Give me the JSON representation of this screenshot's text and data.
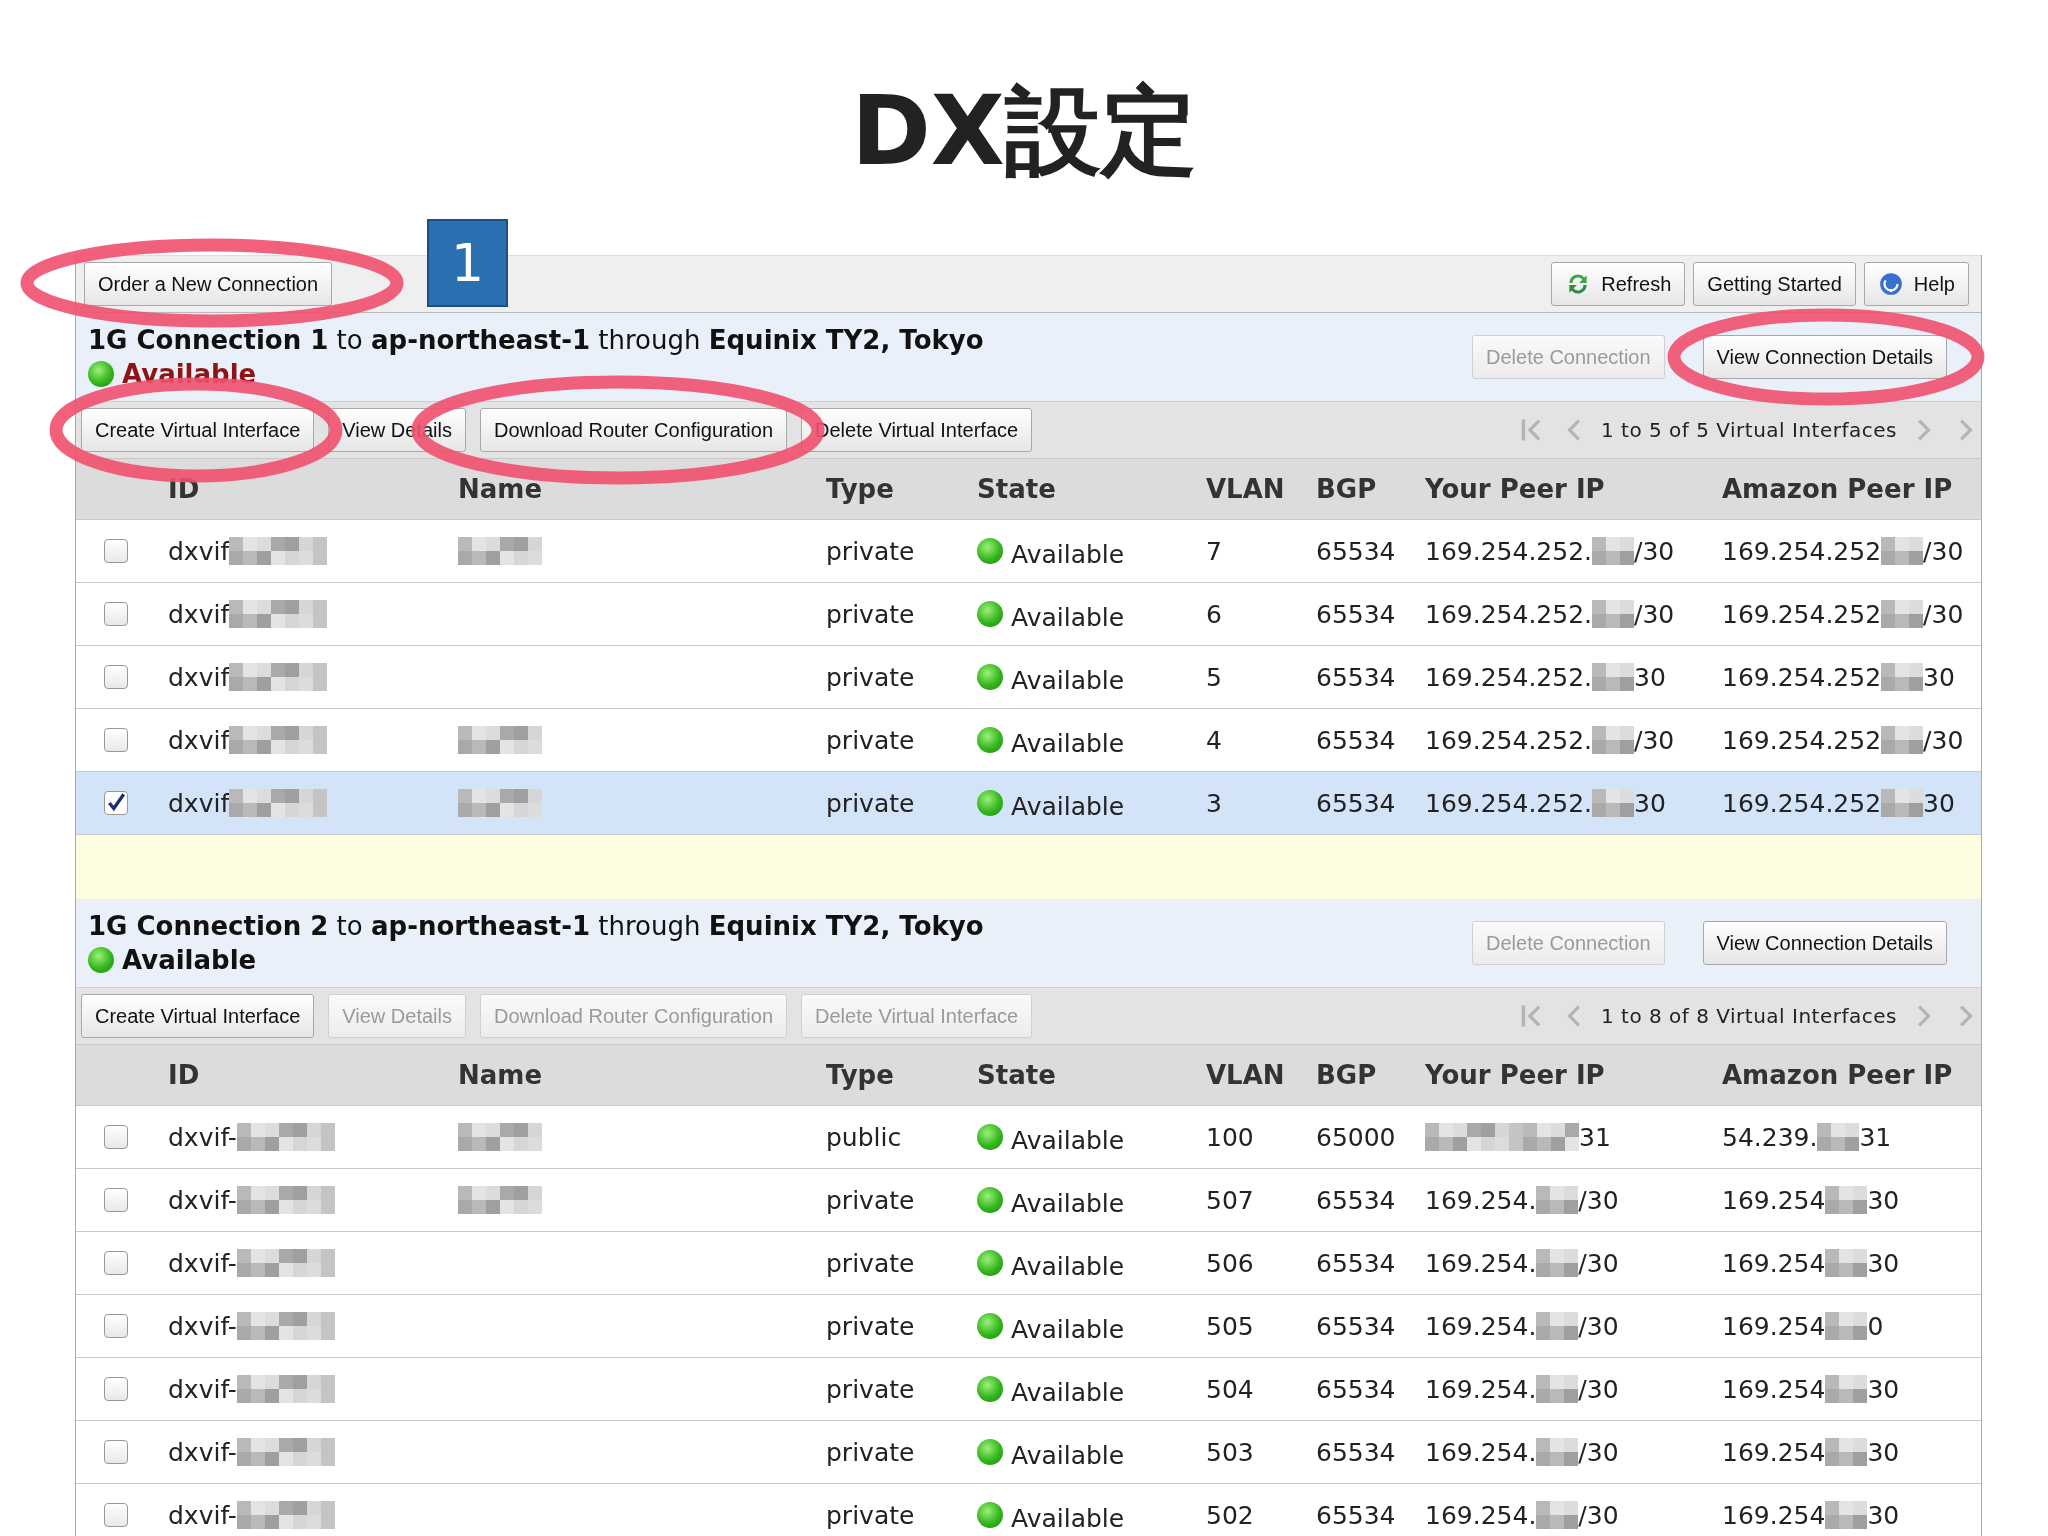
{
  "slide_title": "DX設定",
  "step_badge": "1",
  "toolbar": {
    "left_buttons": [
      {
        "label": "Order a New Connection"
      }
    ],
    "right_buttons": [
      {
        "label": "Refresh"
      },
      {
        "label": "Getting Started"
      },
      {
        "label": "Help"
      }
    ]
  },
  "connections": [
    {
      "title": "**1G Connection 1** to **ap-northeast-1** through **Equinix TY2, Tokyo**",
      "status": "Available",
      "selected": true,
      "actions": [
        {
          "label": "Delete Connection",
          "disabled": true
        },
        {
          "label": "View Connection Details",
          "disabled": false
        }
      ],
      "vi_buttons": [
        {
          "label": "Create Virtual Interface",
          "disabled": false
        },
        {
          "label": "View Details",
          "disabled": false
        },
        {
          "label": "Download Router Configuration",
          "disabled": false
        },
        {
          "label": "Delete Virtual Interface",
          "disabled": false
        }
      ],
      "pager": "1 to 5 of 5 Virtual Interfaces",
      "columns": [
        "ID",
        "Name",
        "Type",
        "State",
        "VLAN",
        "BGP",
        "Your Peer IP",
        "Amazon Peer IP"
      ],
      "rows": [
        {
          "checked": false,
          "selected": false,
          "id": "dxvif",
          "name_redacted": true,
          "type": "private",
          "state": "Available",
          "vlan": "7",
          "bgp": "65534",
          "your_peer_ip": {
            "prefix": "169.254.252.",
            "suffix": "/30"
          },
          "amazon_peer_ip": {
            "prefix": "169.254.252",
            "suffix": "/30"
          }
        },
        {
          "checked": false,
          "selected": false,
          "id": "dxvif",
          "name_redacted": false,
          "type": "private",
          "state": "Available",
          "vlan": "6",
          "bgp": "65534",
          "your_peer_ip": {
            "prefix": "169.254.252.",
            "suffix": "/30"
          },
          "amazon_peer_ip": {
            "prefix": "169.254.252",
            "suffix": "/30"
          }
        },
        {
          "checked": false,
          "selected": false,
          "id": "dxvif",
          "name_redacted": false,
          "type": "private",
          "state": "Available",
          "vlan": "5",
          "bgp": "65534",
          "your_peer_ip": {
            "prefix": "169.254.252.",
            "suffix": "30"
          },
          "amazon_peer_ip": {
            "prefix": "169.254.252",
            "suffix": "30"
          }
        },
        {
          "checked": false,
          "selected": false,
          "id": "dxvif",
          "name_redacted": true,
          "type": "private",
          "state": "Available",
          "vlan": "4",
          "bgp": "65534",
          "your_peer_ip": {
            "prefix": "169.254.252.",
            "suffix": "/30"
          },
          "amazon_peer_ip": {
            "prefix": "169.254.252",
            "suffix": "/30"
          }
        },
        {
          "checked": true,
          "selected": true,
          "id": "dxvif",
          "name_redacted": true,
          "type": "private",
          "state": "Available",
          "vlan": "3",
          "bgp": "65534",
          "your_peer_ip": {
            "prefix": "169.254.252.",
            "suffix": "30"
          },
          "amazon_peer_ip": {
            "prefix": "169.254.252",
            "suffix": "30"
          }
        }
      ]
    },
    {
      "title": "**1G Connection 2** to **ap-northeast-1** through **Equinix TY2, Tokyo**",
      "status": "Available",
      "selected": false,
      "actions": [
        {
          "label": "Delete Connection",
          "disabled": true
        },
        {
          "label": "View Connection Details",
          "disabled": false
        }
      ],
      "vi_buttons": [
        {
          "label": "Create Virtual Interface",
          "disabled": false
        },
        {
          "label": "View Details",
          "disabled": true
        },
        {
          "label": "Download Router Configuration",
          "disabled": true
        },
        {
          "label": "Delete Virtual Interface",
          "disabled": true
        }
      ],
      "pager": "1 to 8 of 8 Virtual Interfaces",
      "columns": [
        "ID",
        "Name",
        "Type",
        "State",
        "VLAN",
        "BGP",
        "Your Peer IP",
        "Amazon Peer IP"
      ],
      "rows": [
        {
          "checked": false,
          "selected": false,
          "id": "dxvif-",
          "name_redacted": true,
          "type": "public",
          "state": "Available",
          "vlan": "100",
          "bgp": "65000",
          "your_peer_ip": {
            "suffix": "31"
          },
          "amazon_peer_ip": {
            "prefix": "54.239.",
            "suffix": "31"
          }
        },
        {
          "checked": false,
          "selected": false,
          "id": "dxvif-",
          "name_redacted": true,
          "type": "private",
          "state": "Available",
          "vlan": "507",
          "bgp": "65534",
          "your_peer_ip": {
            "prefix": "169.254.",
            "suffix": "/30"
          },
          "amazon_peer_ip": {
            "prefix": "169.254",
            "suffix": "30"
          }
        },
        {
          "checked": false,
          "selected": false,
          "id": "dxvif-",
          "name_redacted": false,
          "type": "private",
          "state": "Available",
          "vlan": "506",
          "bgp": "65534",
          "your_peer_ip": {
            "prefix": "169.254.",
            "suffix": "/30"
          },
          "amazon_peer_ip": {
            "prefix": "169.254",
            "suffix": "30"
          }
        },
        {
          "checked": false,
          "selected": false,
          "id": "dxvif-",
          "name_redacted": false,
          "type": "private",
          "state": "Available",
          "vlan": "505",
          "bgp": "65534",
          "your_peer_ip": {
            "prefix": "169.254.",
            "suffix": "/30"
          },
          "amazon_peer_ip": {
            "prefix": "169.254",
            "suffix": "0"
          }
        },
        {
          "checked": false,
          "selected": false,
          "id": "dxvif-",
          "name_redacted": false,
          "type": "private",
          "state": "Available",
          "vlan": "504",
          "bgp": "65534",
          "your_peer_ip": {
            "prefix": "169.254.",
            "suffix": "/30"
          },
          "amazon_peer_ip": {
            "prefix": "169.254",
            "suffix": "30"
          }
        },
        {
          "checked": false,
          "selected": false,
          "id": "dxvif-",
          "name_redacted": false,
          "type": "private",
          "state": "Available",
          "vlan": "503",
          "bgp": "65534",
          "your_peer_ip": {
            "prefix": "169.254.",
            "suffix": "/30"
          },
          "amazon_peer_ip": {
            "prefix": "169.254",
            "suffix": "30"
          }
        },
        {
          "checked": false,
          "selected": false,
          "id": "dxvif-",
          "name_redacted": false,
          "type": "private",
          "state": "Available",
          "vlan": "502",
          "bgp": "65534",
          "your_peer_ip": {
            "prefix": "169.254.",
            "suffix": "/30"
          },
          "amazon_peer_ip": {
            "prefix": "169.254",
            "suffix": "30"
          }
        }
      ]
    }
  ]
}
